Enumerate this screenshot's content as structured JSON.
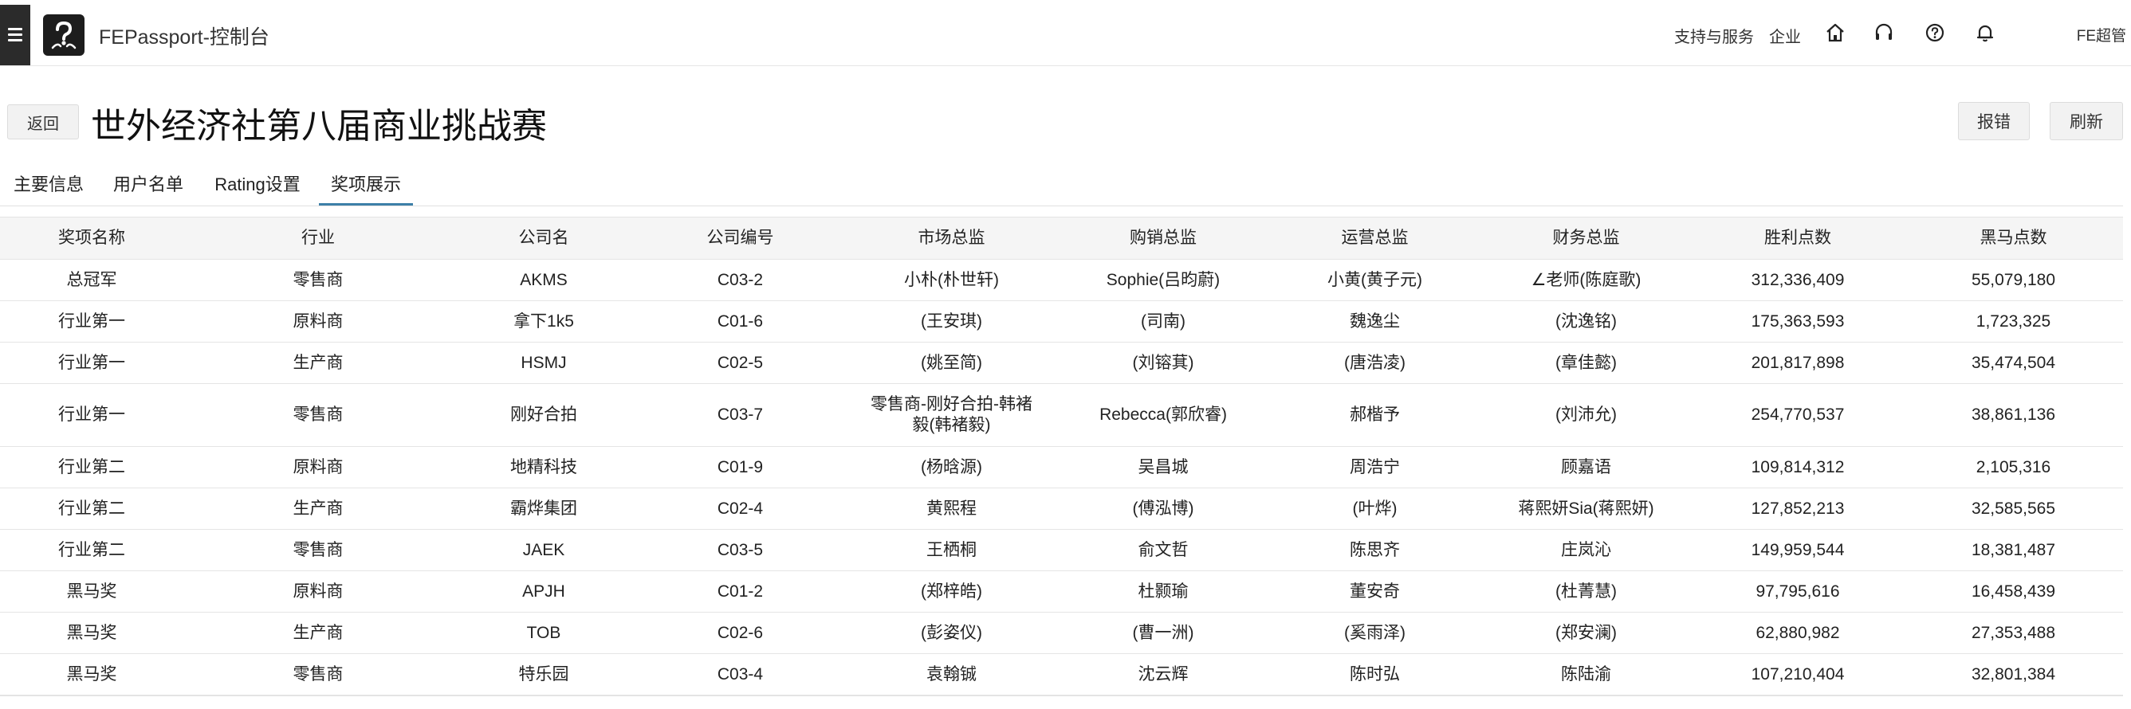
{
  "topbar": {
    "app_title": "FEPassport-控制台",
    "support_label": "支持与服务",
    "enterprise_label": "企业",
    "user_name": "FE超管"
  },
  "header": {
    "back_label": "返回",
    "title": "世外经济社第八届商业挑战赛",
    "report_label": "报错",
    "refresh_label": "刷新"
  },
  "tabs": [
    {
      "label": "主要信息"
    },
    {
      "label": "用户名单"
    },
    {
      "label": "Rating设置"
    },
    {
      "label": "奖项展示"
    }
  ],
  "table": {
    "columns": [
      "奖项名称",
      "行业",
      "公司名",
      "公司编号",
      "市场总监",
      "购销总监",
      "运营总监",
      "财务总监",
      "胜利点数",
      "黑马点数"
    ],
    "rows": [
      [
        "总冠军",
        "零售商",
        "AKMS",
        "C03-2",
        "小朴(朴世轩)",
        "Sophie(吕昀蔚)",
        "小黄(黄子元)",
        "∠老师(陈庭歌)",
        "312,336,409",
        "55,079,180"
      ],
      [
        "行业第一",
        "原料商",
        "拿下1k5",
        "C01-6",
        "(王安琪)",
        "(司南)",
        "魏逸尘",
        "(沈逸铭)",
        "175,363,593",
        "1,723,325"
      ],
      [
        "行业第一",
        "生产商",
        "HSMJ",
        "C02-5",
        "(姚至简)",
        "(刘镕萁)",
        "(唐浩凌)",
        "(章佳懿)",
        "201,817,898",
        "35,474,504"
      ],
      [
        "行业第一",
        "零售商",
        "刚好合拍",
        "C03-7",
        "零售商-刚好合拍-韩褚毅(韩褚毅)",
        "Rebecca(郭欣睿)",
        "郝楷予",
        "(刘沛允)",
        "254,770,537",
        "38,861,136"
      ],
      [
        "行业第二",
        "原料商",
        "地精科技",
        "C01-9",
        "(杨晗源)",
        "吴昌城",
        "周浩宁",
        "顾嘉语",
        "109,814,312",
        "2,105,316"
      ],
      [
        "行业第二",
        "生产商",
        "霸烨集团",
        "C02-4",
        "黄熙程",
        "(傅泓博)",
        "(叶烨)",
        "蒋熙妍Sia(蒋熙妍)",
        "127,852,213",
        "32,585,565"
      ],
      [
        "行业第二",
        "零售商",
        "JAEK",
        "C03-5",
        "王栖桐",
        "俞文哲",
        "陈思齐",
        "庄岚沁",
        "149,959,544",
        "18,381,487"
      ],
      [
        "黑马奖",
        "原料商",
        "APJH",
        "C01-2",
        "(郑梓皓)",
        "杜颢瑜",
        "董安奇",
        "(杜菁慧)",
        "97,795,616",
        "16,458,439"
      ],
      [
        "黑马奖",
        "生产商",
        "TOB",
        "C02-6",
        "(彭姿仪)",
        "(曹一洲)",
        "(奚雨泽)",
        "(郑安澜)",
        "62,880,982",
        "27,353,488"
      ],
      [
        "黑马奖",
        "零售商",
        "特乐园",
        "C03-4",
        "袁翰铖",
        "沈云辉",
        "陈时弘",
        "陈陆渝",
        "107,210,404",
        "32,801,384"
      ]
    ]
  }
}
